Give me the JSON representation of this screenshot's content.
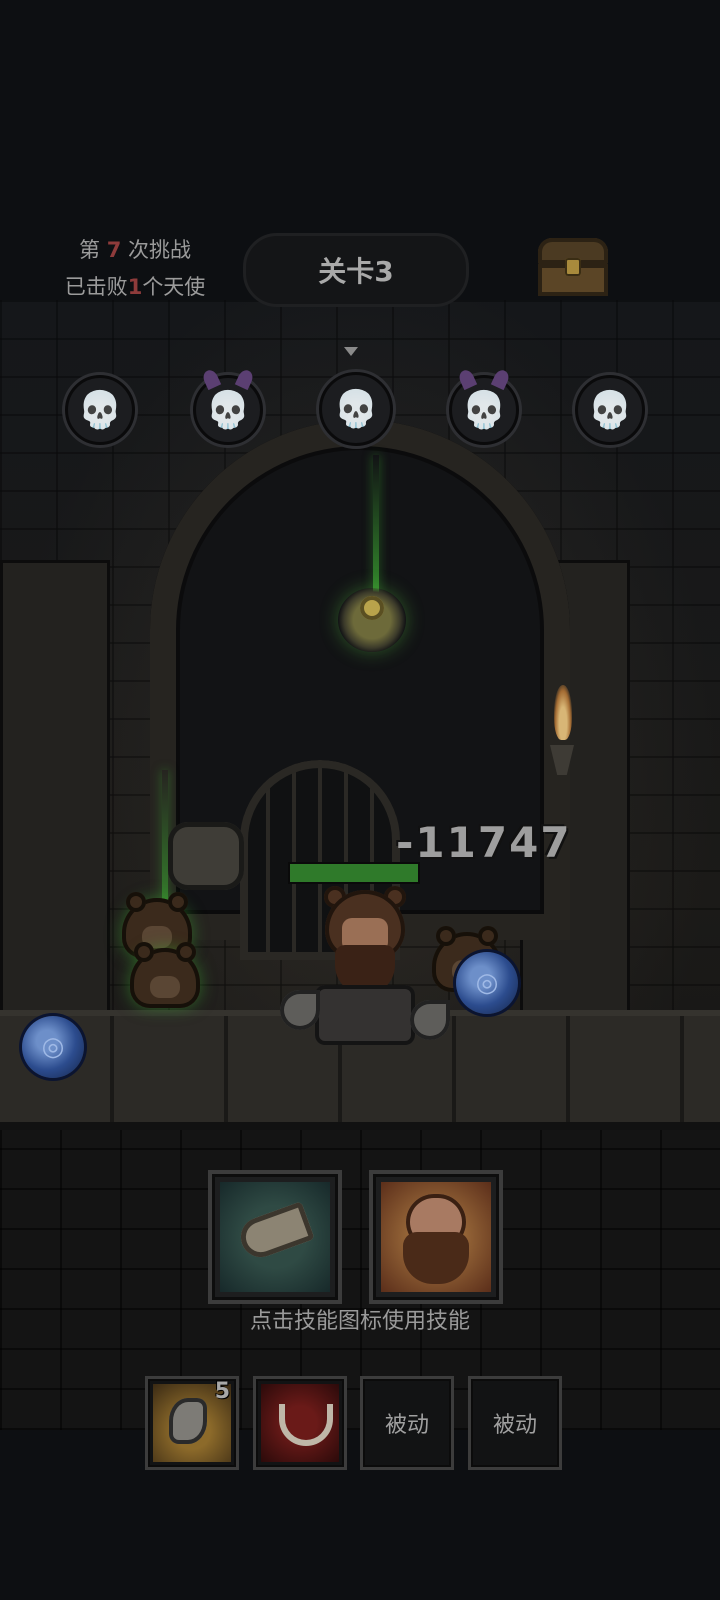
{
  "hud": {
    "challenge_prefix": "第",
    "challenge_count": "7",
    "challenge_suffix": "次挑战",
    "defeated_prefix": "已击败",
    "defeated_count": "1",
    "defeated_suffix": "个天使",
    "level_label": "关卡3"
  },
  "stage_nodes": [
    {
      "type": "skull-icon",
      "glyph": "💀"
    },
    {
      "type": "demon-skull-icon",
      "glyph": "💀"
    },
    {
      "type": "skull-icon",
      "glyph": "💀",
      "current": true
    },
    {
      "type": "demon-skull-icon",
      "glyph": "💀"
    },
    {
      "type": "skull-icon",
      "glyph": "💀"
    }
  ],
  "battle": {
    "damage_text": "-11747",
    "hero_hp_fraction": 1.0
  },
  "skills": {
    "active": [
      {
        "name": "war-horn-skill"
      },
      {
        "name": "rage-skill"
      }
    ],
    "hint": "点击技能图标使用技能",
    "passive": [
      {
        "name": "axe-skill",
        "badge": "5"
      },
      {
        "name": "fang-skill"
      },
      {
        "label": "被动"
      },
      {
        "label": "被动"
      }
    ]
  },
  "colors": {
    "accent_red": "#8e3b3b",
    "hp_green": "#2f7a2a",
    "glow_green": "#3caa32"
  }
}
